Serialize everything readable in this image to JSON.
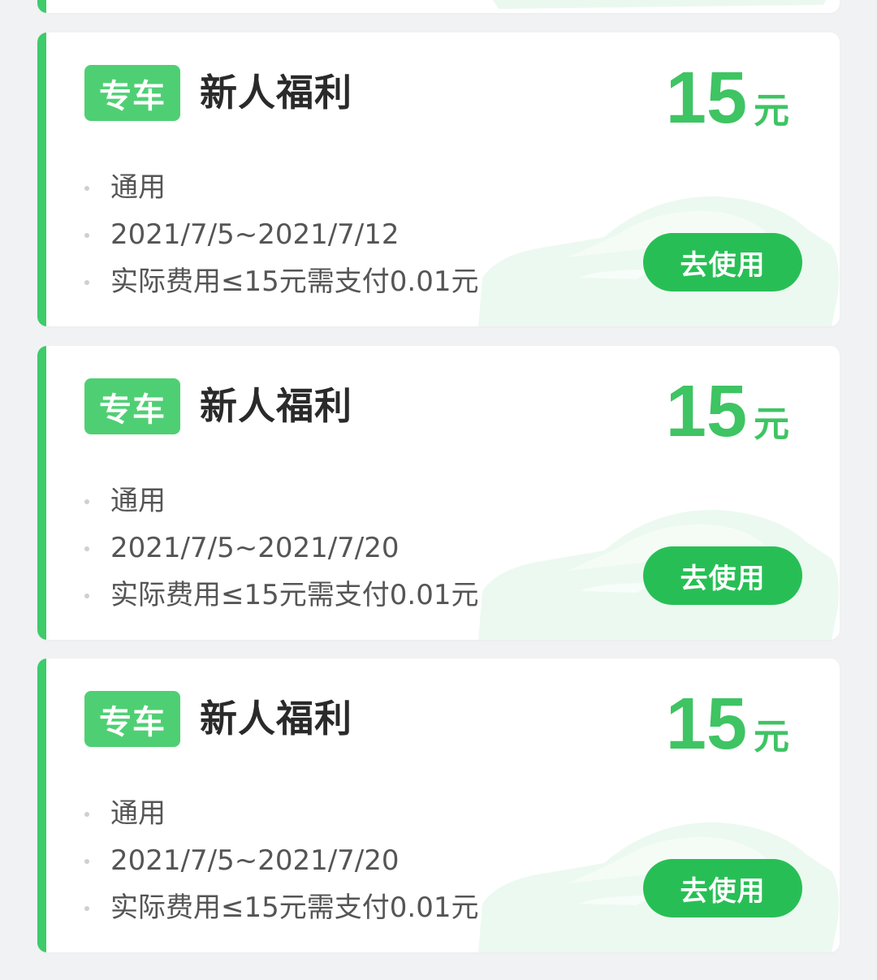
{
  "coupons": [
    {
      "tag": "专车",
      "title": "新人福利",
      "amount": "15",
      "unit": "元",
      "scope": "通用",
      "validity": "2021/7/5~2021/7/12",
      "rule": "实际费用≤15元需支付0.01元",
      "button": "去使用"
    },
    {
      "tag": "专车",
      "title": "新人福利",
      "amount": "15",
      "unit": "元",
      "scope": "通用",
      "validity": "2021/7/5~2021/7/20",
      "rule": "实际费用≤15元需支付0.01元",
      "button": "去使用"
    },
    {
      "tag": "专车",
      "title": "新人福利",
      "amount": "15",
      "unit": "元",
      "scope": "通用",
      "validity": "2021/7/5~2021/7/20",
      "rule": "实际费用≤15元需支付0.01元",
      "button": "去使用"
    }
  ],
  "colors": {
    "accent": "#3ecb6a",
    "button": "#27bf55",
    "amount": "#3ec463",
    "background": "#f1f2f4"
  },
  "icons": {
    "card_background": "car-silhouette-icon"
  }
}
